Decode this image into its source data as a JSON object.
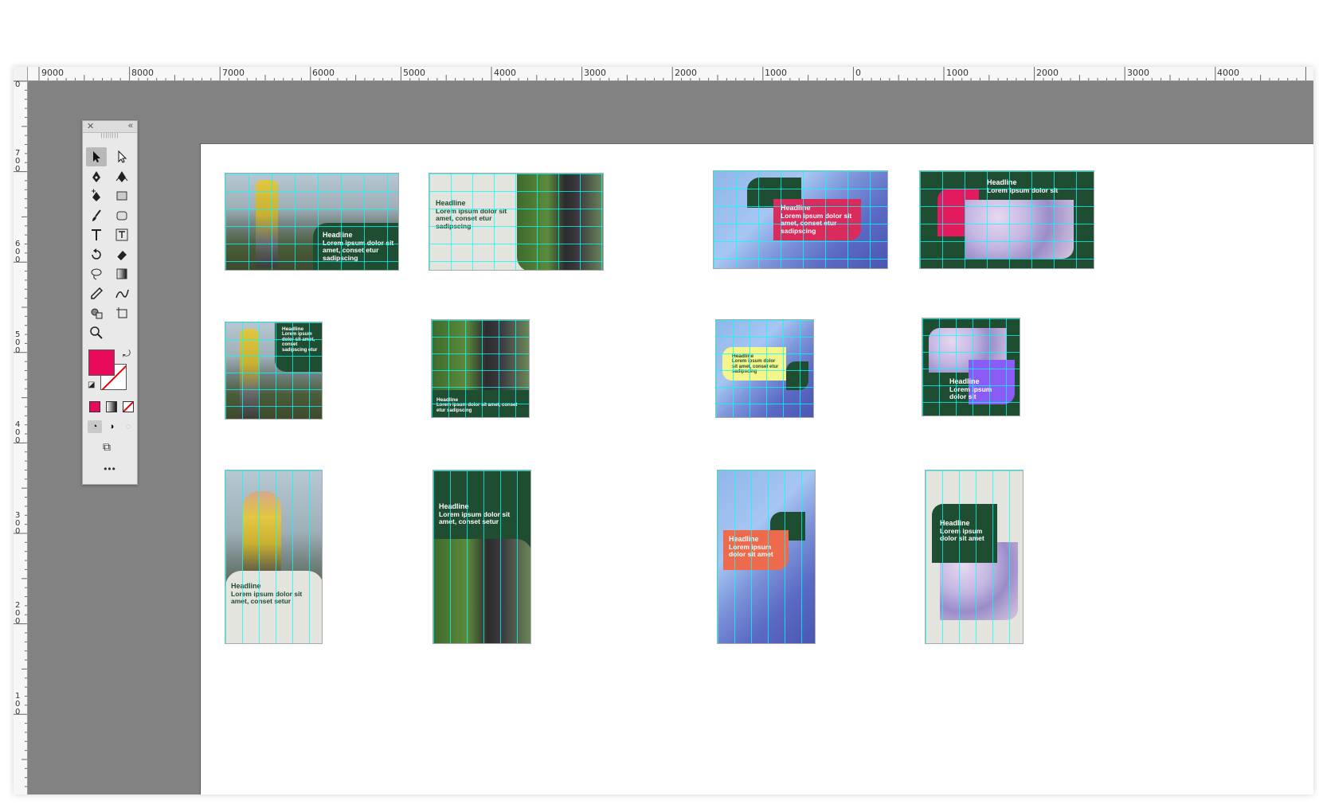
{
  "ruler": {
    "h_labels": [
      "9000",
      "8000",
      "7000",
      "6000",
      "5000",
      "4000",
      "3000",
      "2000",
      "1000",
      "0",
      "1000",
      "2000",
      "3000",
      "4000"
    ],
    "v_labels": [
      "0",
      "700",
      "600",
      "500",
      "400",
      "300",
      "200",
      "100"
    ]
  },
  "tools": {
    "icons": [
      "selection-tool-icon",
      "direct-selection-tool-icon",
      "pen-tool-icon",
      "curvature-pen-icon",
      "add-anchor-icon",
      "rectangle-tool-icon",
      "paintbrush-tool-icon",
      "rounded-rectangle-icon",
      "type-tool-icon",
      "area-type-icon",
      "rotate-tool-icon",
      "eraser-tool-icon",
      "lasso-tool-icon",
      "gradient-tool-icon",
      "eyedropper-tool-icon",
      "blend-tool-icon",
      "shape-builder-icon",
      "artboard-tool-icon",
      "zoom-tool-icon"
    ],
    "more_label": "•••",
    "fill_color": "#e80a5a"
  },
  "artboards": {
    "a1": {
      "headline": "Headline",
      "body": "Lorem ipsum dolor sit amet, conset etur sadipscing"
    },
    "a2": {
      "headline": "Headline",
      "body": "Lorem ipsum dolor sit amet, conset etur sadipscing"
    },
    "a3": {
      "headline": "Headline",
      "body": "Lorem ipsum dolor sit amet, conset etur sadipscing"
    },
    "a4": {
      "headline": "Headline",
      "body": "Lorem ipsum dolor sit"
    },
    "a5": {
      "headline": "Headline",
      "body": "Lorem ipsum dolor sit amet, conset sadipscing etur"
    },
    "a6": {
      "headline": "Headline",
      "body": "Lorem ipsum dolor sit amet, conset etur sadipscing"
    },
    "a7": {
      "headline": "Headline",
      "body": "Lorem ipsum dolor sit amet, conset etur sadipscing"
    },
    "a8": {
      "headline": "Headline",
      "body": "Lorem ipsum dolor sit"
    },
    "a9": {
      "headline": "Headline",
      "body": "Lorem ipsum dolor sit amet, conset setur"
    },
    "a10": {
      "headline": "Headline",
      "body": "Lorem ipsum dolor sit amet, conset setur"
    },
    "a11": {
      "headline": "Headline",
      "body": "Lorem ipsum dolor sit amet"
    },
    "a12": {
      "headline": "Headline",
      "body": "Lorem ipsum dolor sit amet"
    }
  },
  "colors": {
    "brand_green": "#1f4d32",
    "accent_pink": "#e80a5a",
    "accent_coral": "#ee6a4d",
    "accent_yellow": "#f4f58a",
    "accent_purple": "#8a5cf5",
    "cream": "#e4e4de"
  }
}
